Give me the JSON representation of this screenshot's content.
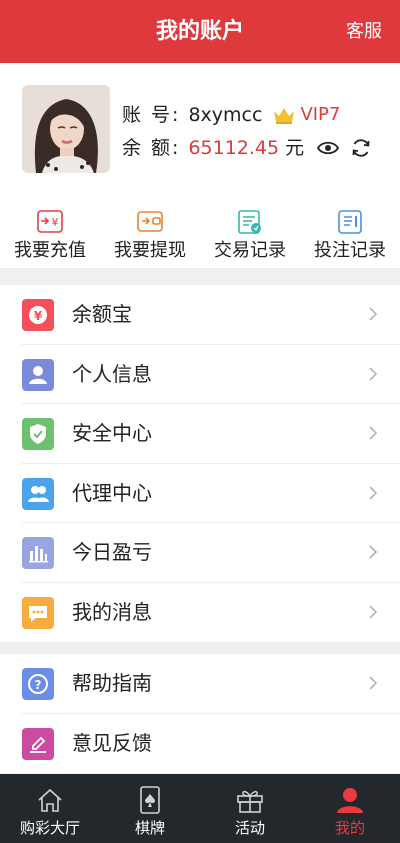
{
  "header": {
    "title": "我的账户",
    "service": "客服"
  },
  "account": {
    "account_label": "账 号:",
    "username": "8xymcc",
    "vip": "VIP7",
    "balance_label": "余 额:",
    "balance": "65112.45",
    "unit": "元"
  },
  "quick": [
    {
      "label": "我要充值",
      "icon": "deposit-icon"
    },
    {
      "label": "我要提现",
      "icon": "withdraw-icon"
    },
    {
      "label": "交易记录",
      "icon": "transaction-record-icon"
    },
    {
      "label": "投注记录",
      "icon": "bet-record-icon"
    }
  ],
  "menu": [
    {
      "label": "余额宝",
      "icon": "yuebao-icon",
      "color": "#f2505a"
    },
    {
      "label": "个人信息",
      "icon": "person-icon",
      "color": "#7a8bdc"
    },
    {
      "label": "安全中心",
      "icon": "shield-icon",
      "color": "#6dc06f"
    },
    {
      "label": "代理中心",
      "icon": "agent-icon",
      "color": "#4da3ea"
    },
    {
      "label": "今日盈亏",
      "icon": "bar-chart-icon",
      "color": "#9aa4e0"
    },
    {
      "label": "我的消息",
      "icon": "message-icon",
      "color": "#f6ac3e"
    }
  ],
  "menu2": [
    {
      "label": "帮助指南",
      "icon": "help-icon",
      "color": "#6c8de6"
    },
    {
      "label": "意见反馈",
      "icon": "feedback-icon",
      "color": "#cc4a9f"
    }
  ],
  "tabs": [
    {
      "label": "购彩大厅",
      "icon": "home-icon"
    },
    {
      "label": "棋牌",
      "icon": "cards-icon"
    },
    {
      "label": "活动",
      "icon": "gift-icon"
    },
    {
      "label": "我的",
      "icon": "user-icon"
    }
  ],
  "colors": {
    "brand": "#de3a3d",
    "tabbar": "#23282d",
    "vip": "#e23b3e",
    "crown": "#f2c230"
  }
}
